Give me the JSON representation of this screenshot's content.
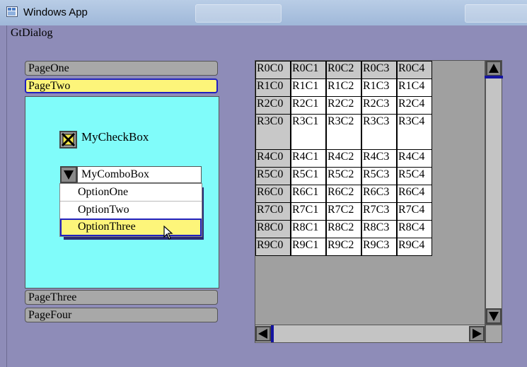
{
  "window": {
    "title": "Windows App",
    "dialog_title": "GtDialog"
  },
  "tabs": [
    {
      "label": "PageOne",
      "active": false
    },
    {
      "label": "PageTwo",
      "active": true
    },
    {
      "label": "PageThree",
      "active": false
    },
    {
      "label": "PageFour",
      "active": false
    }
  ],
  "checkbox": {
    "label": "MyCheckBox",
    "checked": true
  },
  "combobox": {
    "value": "MyComboBox",
    "options": [
      "OptionOne",
      "OptionTwo",
      "OptionThree"
    ],
    "selected_index": 2
  },
  "grid": {
    "rows": [
      [
        "R0C0",
        "R0C1",
        "R0C2",
        "R0C3",
        "R0C4"
      ],
      [
        "R1C0",
        "R1C1",
        "R1C2",
        "R1C3",
        "R1C4"
      ],
      [
        "R2C0",
        "R2C1",
        "R2C2",
        "R2C3",
        "R2C4"
      ],
      [
        "R3C0",
        "R3C1",
        "R3C2",
        "R3C3",
        "R3C4"
      ],
      [
        "R4C0",
        "R4C1",
        "R4C2",
        "R4C3",
        "R4C4"
      ],
      [
        "R5C0",
        "R5C1",
        "R5C2",
        "R5C3",
        "R5C4"
      ],
      [
        "R6C0",
        "R6C1",
        "R6C2",
        "R6C3",
        "R6C4"
      ],
      [
        "R7C0",
        "R7C1",
        "R7C2",
        "R7C3",
        "R7C4"
      ],
      [
        "R8C0",
        "R8C1",
        "R8C2",
        "R8C3",
        "R8C4"
      ],
      [
        "R9C0",
        "R9C1",
        "R9C2",
        "R9C3",
        "R9C4"
      ]
    ]
  },
  "colors": {
    "background": "#8e8cb8",
    "page_background": "#80fcfa",
    "selected_highlight": "#fdf57a",
    "focus_border": "#2020c0"
  }
}
